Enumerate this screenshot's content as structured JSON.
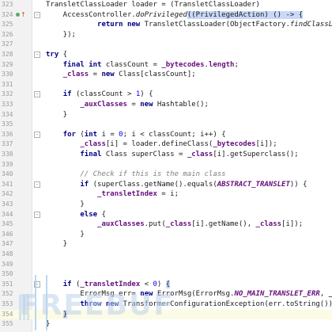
{
  "editor": {
    "language": "Java",
    "lines": [
      {
        "n": "323",
        "segs": [
          {
            "t": "TransletClassLoader loader = (TransletClassLoader)",
            "c": ""
          }
        ]
      },
      {
        "n": "324",
        "segs": [
          {
            "t": "    AccessController.",
            "c": ""
          },
          {
            "t": "doPrivileged",
            "c": "italic"
          },
          {
            "t": "((PrivilegedAction) () -> {",
            "c": "hl-paren"
          }
        ]
      },
      {
        "n": "325",
        "segs": [
          {
            "t": "            ",
            "c": ""
          },
          {
            "t": "return new",
            "c": "kw"
          },
          {
            "t": " TransletClassLoader(ObjectFactory.",
            "c": ""
          },
          {
            "t": "findClassLoader",
            "c": "italic"
          },
          {
            "t": "());",
            "c": ""
          }
        ]
      },
      {
        "n": "326",
        "segs": [
          {
            "t": "    });",
            "c": ""
          }
        ]
      },
      {
        "n": "327",
        "segs": []
      },
      {
        "n": "328",
        "segs": [
          {
            "t": "try",
            "c": "kw"
          },
          {
            "t": " {",
            "c": ""
          }
        ]
      },
      {
        "n": "329",
        "segs": [
          {
            "t": "    ",
            "c": ""
          },
          {
            "t": "final int",
            "c": "kw"
          },
          {
            "t": " classCount = ",
            "c": ""
          },
          {
            "t": "_bytecodes",
            "c": "field"
          },
          {
            "t": ".",
            "c": ""
          },
          {
            "t": "length",
            "c": "field"
          },
          {
            "t": ";",
            "c": ""
          }
        ]
      },
      {
        "n": "330",
        "segs": [
          {
            "t": "    ",
            "c": ""
          },
          {
            "t": "_class",
            "c": "field"
          },
          {
            "t": " = ",
            "c": ""
          },
          {
            "t": "new",
            "c": "kw"
          },
          {
            "t": " Class[classCount];",
            "c": ""
          }
        ]
      },
      {
        "n": "331",
        "segs": []
      },
      {
        "n": "332",
        "segs": [
          {
            "t": "    ",
            "c": ""
          },
          {
            "t": "if",
            "c": "kw"
          },
          {
            "t": " (classCount > ",
            "c": ""
          },
          {
            "t": "1",
            "c": "num"
          },
          {
            "t": ") {",
            "c": ""
          }
        ]
      },
      {
        "n": "333",
        "segs": [
          {
            "t": "        ",
            "c": ""
          },
          {
            "t": "_auxClasses",
            "c": "field"
          },
          {
            "t": " = ",
            "c": ""
          },
          {
            "t": "new",
            "c": "kw"
          },
          {
            "t": " Hashtable();",
            "c": ""
          }
        ]
      },
      {
        "n": "334",
        "segs": [
          {
            "t": "    }",
            "c": ""
          }
        ]
      },
      {
        "n": "335",
        "segs": []
      },
      {
        "n": "336",
        "segs": [
          {
            "t": "    ",
            "c": ""
          },
          {
            "t": "for",
            "c": "kw"
          },
          {
            "t": " (",
            "c": ""
          },
          {
            "t": "int",
            "c": "kw"
          },
          {
            "t": " i = ",
            "c": ""
          },
          {
            "t": "0",
            "c": "num"
          },
          {
            "t": "; i < classCount; i++) {",
            "c": ""
          }
        ]
      },
      {
        "n": "337",
        "segs": [
          {
            "t": "        ",
            "c": ""
          },
          {
            "t": "_class",
            "c": "field"
          },
          {
            "t": "[i] = loader.defineClass(",
            "c": ""
          },
          {
            "t": "_bytecodes",
            "c": "field"
          },
          {
            "t": "[i]);",
            "c": ""
          }
        ]
      },
      {
        "n": "338",
        "segs": [
          {
            "t": "        ",
            "c": ""
          },
          {
            "t": "final",
            "c": "kw"
          },
          {
            "t": " Class superClass = ",
            "c": ""
          },
          {
            "t": "_class",
            "c": "field"
          },
          {
            "t": "[i].getSuperclass();",
            "c": ""
          }
        ]
      },
      {
        "n": "339",
        "segs": []
      },
      {
        "n": "340",
        "segs": [
          {
            "t": "        // Check if this is the main class",
            "c": "cmt"
          }
        ]
      },
      {
        "n": "341",
        "segs": [
          {
            "t": "        ",
            "c": ""
          },
          {
            "t": "if",
            "c": "kw"
          },
          {
            "t": " (superClass.getName().equals(",
            "c": ""
          },
          {
            "t": "ABSTRACT_TRANSLET",
            "c": "const"
          },
          {
            "t": ")) {",
            "c": ""
          }
        ]
      },
      {
        "n": "342",
        "segs": [
          {
            "t": "            ",
            "c": ""
          },
          {
            "t": "_transletIndex",
            "c": "field"
          },
          {
            "t": " = i;",
            "c": ""
          }
        ]
      },
      {
        "n": "343",
        "segs": [
          {
            "t": "        }",
            "c": ""
          }
        ]
      },
      {
        "n": "344",
        "segs": [
          {
            "t": "        ",
            "c": ""
          },
          {
            "t": "else",
            "c": "kw"
          },
          {
            "t": " {",
            "c": ""
          }
        ]
      },
      {
        "n": "345",
        "segs": [
          {
            "t": "            ",
            "c": ""
          },
          {
            "t": "_auxClasses",
            "c": "field"
          },
          {
            "t": ".put(",
            "c": ""
          },
          {
            "t": "_class",
            "c": "field"
          },
          {
            "t": "[i].getName(), ",
            "c": ""
          },
          {
            "t": "_class",
            "c": "field"
          },
          {
            "t": "[i]);",
            "c": ""
          }
        ]
      },
      {
        "n": "346",
        "segs": [
          {
            "t": "        }",
            "c": ""
          }
        ]
      },
      {
        "n": "347",
        "segs": [
          {
            "t": "    }",
            "c": ""
          }
        ]
      },
      {
        "n": "348",
        "segs": []
      },
      {
        "n": "349",
        "segs": []
      },
      {
        "n": "350",
        "segs": []
      },
      {
        "n": "351",
        "segs": [
          {
            "t": "    ",
            "c": ""
          },
          {
            "t": "if",
            "c": "kw"
          },
          {
            "t": " (",
            "c": ""
          },
          {
            "t": "_transletIndex",
            "c": "field"
          },
          {
            "t": " < ",
            "c": ""
          },
          {
            "t": "0",
            "c": "num"
          },
          {
            "t": ") ",
            "c": ""
          },
          {
            "t": "{",
            "c": "hl-paren"
          }
        ]
      },
      {
        "n": "352",
        "segs": [
          {
            "t": "        ErrorMsg err= ",
            "c": ""
          },
          {
            "t": "new",
            "c": "kw"
          },
          {
            "t": " ErrorMsg(ErrorMsg.",
            "c": ""
          },
          {
            "t": "NO_MAIN_TRANSLET_ERR",
            "c": "const"
          },
          {
            "t": ", ",
            "c": ""
          },
          {
            "t": "_name",
            "c": "field"
          },
          {
            "t": ");",
            "c": ""
          }
        ]
      },
      {
        "n": "353",
        "segs": [
          {
            "t": "        ",
            "c": ""
          },
          {
            "t": "throw new",
            "c": "kw"
          },
          {
            "t": " TransformerConfigurationException(err.toString());",
            "c": ""
          }
        ]
      },
      {
        "n": "354",
        "segs": [
          {
            "t": "    ",
            "c": ""
          },
          {
            "t": "}",
            "c": "hl-paren"
          }
        ]
      },
      {
        "n": "355",
        "segs": [
          {
            "t": "}",
            "c": ""
          }
        ]
      }
    ],
    "highlighted_line": "354",
    "gutter_marker_line": "324",
    "gutter_marker_icon": "lambda-marker-icon"
  },
  "watermark": {
    "text": "FREEBUF"
  },
  "colors": {
    "keyword": "#000080",
    "field": "#660e7a",
    "number": "#0000ff",
    "comment": "#808080"
  }
}
